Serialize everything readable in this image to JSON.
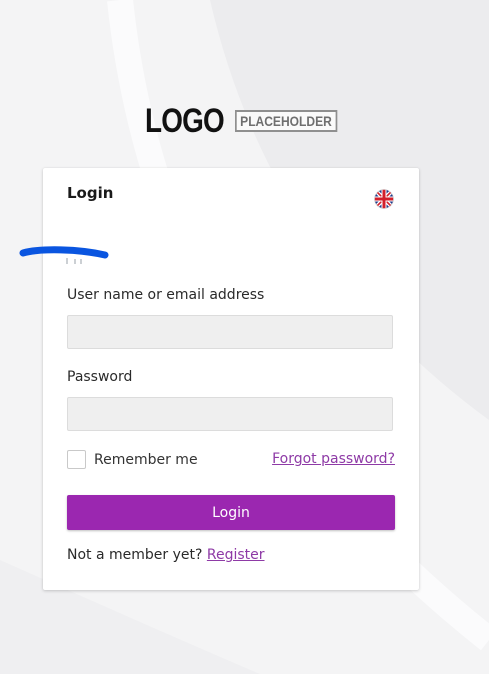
{
  "logo": {
    "word": "LOGO",
    "tag": "PLACEHOLDER"
  },
  "card": {
    "title": "Login",
    "language_icon": "uk-flag-icon"
  },
  "form": {
    "username_label": "User name or email address",
    "username_value": "",
    "password_label": "Password",
    "password_value": "",
    "remember_label": "Remember me",
    "remember_checked": false,
    "forgot_label": "Forgot password?",
    "submit_label": "Login"
  },
  "register": {
    "prompt": "Not a member yet?",
    "link_label": "Register"
  },
  "colors": {
    "accent": "#9b27b0",
    "link": "#8e3aa6",
    "page_background": "#f4f4f5",
    "redaction": "#0a55e0"
  }
}
